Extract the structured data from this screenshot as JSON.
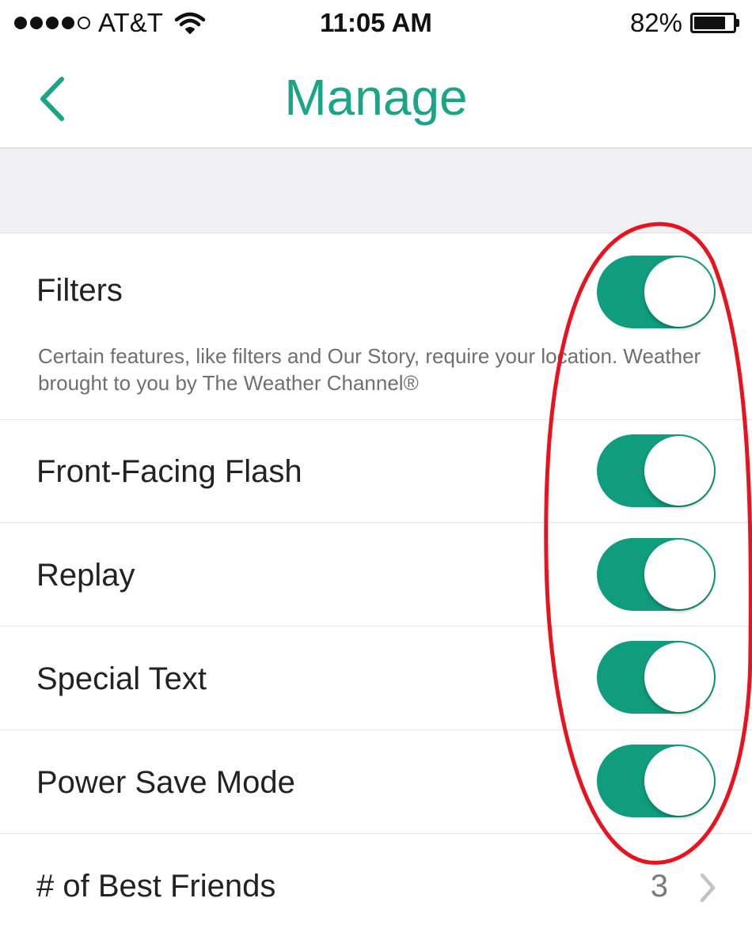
{
  "status_bar": {
    "carrier": "AT&T",
    "signal_bars_filled": 4,
    "signal_bars_total": 5,
    "time": "11:05 AM",
    "battery_percent": "82%",
    "battery_level": 0.82
  },
  "nav": {
    "title": "Manage",
    "back_icon": "chevron-left-icon"
  },
  "colors": {
    "accent": "#1aa587",
    "toggle_on": "#0f9d7d",
    "annotation": "#e8131f"
  },
  "settings": {
    "filters": {
      "label": "Filters",
      "note": "Certain features, like filters and Our Story, require your location. Weather brought to you by The Weather Channel®",
      "enabled": true
    },
    "front_facing_flash": {
      "label": "Front-Facing Flash",
      "enabled": true
    },
    "replay": {
      "label": "Replay",
      "enabled": true
    },
    "special_text": {
      "label": "Special Text",
      "enabled": true
    },
    "power_save_mode": {
      "label": "Power Save Mode",
      "enabled": true
    },
    "best_friends": {
      "label": "# of Best Friends",
      "value": "3"
    }
  }
}
